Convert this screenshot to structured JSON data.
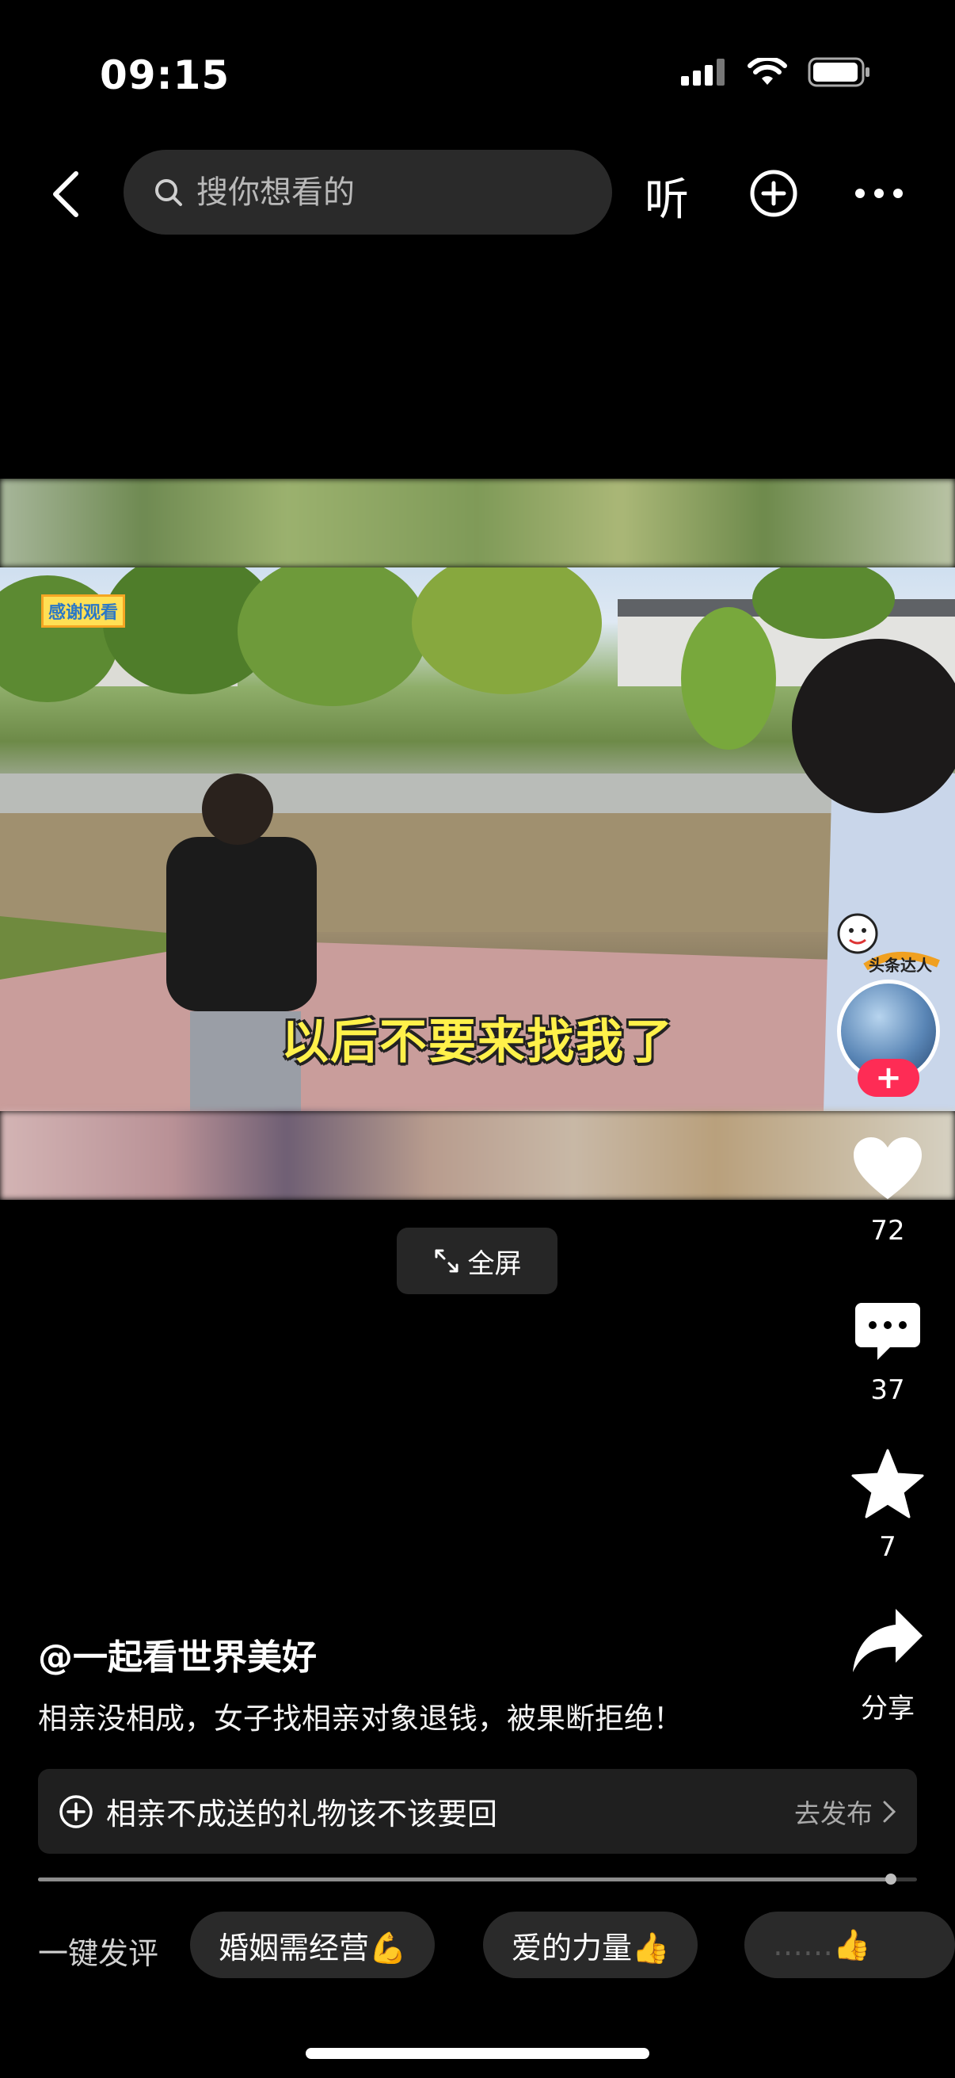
{
  "status_bar": {
    "time": "09:15"
  },
  "header": {
    "search_placeholder": "搜你想看的",
    "listen_label": "听"
  },
  "video": {
    "subtitle": "以后不要来找我了",
    "corner_badge": "感谢观看",
    "fullscreen_label": "全屏"
  },
  "rail": {
    "avatar_badge": "头条达人",
    "likes": "72",
    "comments": "37",
    "favorites": "7",
    "share_label": "分享"
  },
  "caption": {
    "author": "@一起看世界美好",
    "description": "相亲没相成，女子找相亲对象退钱，被果断拒绝！"
  },
  "topic": {
    "text": "相亲不成送的礼物该不该要回",
    "action": "去发布"
  },
  "progress": {
    "fraction": 0.97
  },
  "quick_comments": {
    "label": "一键发评",
    "chips": [
      "婚姻需经营💪",
      "爱的力量👍",
      "……👍"
    ]
  }
}
